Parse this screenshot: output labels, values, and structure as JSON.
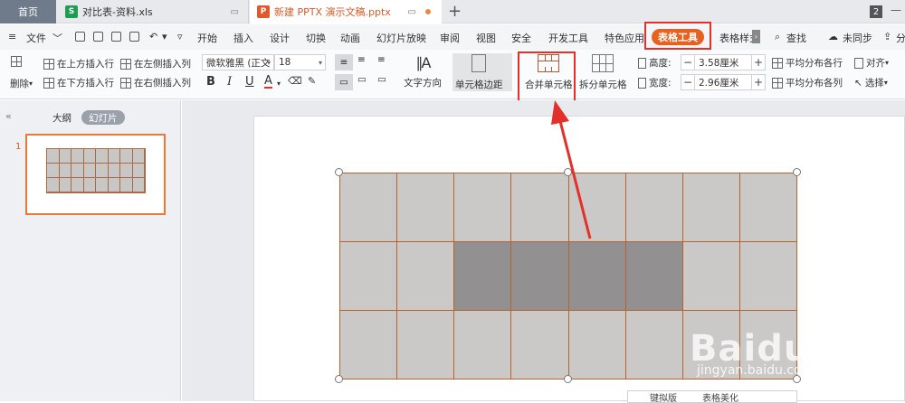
{
  "tabs": {
    "home": "首页",
    "xls": {
      "icon": "S",
      "label": "对比表-资料.xls"
    },
    "ppt": {
      "icon": "P",
      "label": "新建 PPTX 演示文稿.pptx"
    },
    "new_tab": "+",
    "window_count": "2"
  },
  "menu": {
    "file": "文件",
    "items": [
      "开始",
      "插入",
      "设计",
      "切换",
      "动画",
      "幻灯片放映",
      "审阅",
      "视图",
      "安全",
      "开发工具",
      "特色应用"
    ],
    "table_tools": "表格工具",
    "table_style": "表格样式",
    "search": "查找",
    "sync": "未同步",
    "share": "分"
  },
  "ribbon": {
    "delete": "删除",
    "insert_above": "在上方插入行",
    "insert_below": "在下方插入行",
    "insert_left": "在左侧插入列",
    "insert_right": "在右侧插入列",
    "font": "微软雅黑 (正文",
    "font_size": "18",
    "bold": "B",
    "italic": "I",
    "underline": "U",
    "font_color": "A",
    "text_direction": "文字方向",
    "cell_margin": "单元格边距",
    "merge_cells": "合并单元格",
    "split_cells": "拆分单元格",
    "height_label": "高度:",
    "height_value": "3.58厘米",
    "width_label": "宽度:",
    "width_value": "2.96厘米",
    "distribute_rows": "平均分布各行",
    "distribute_cols": "平均分布各列",
    "align": "对齐",
    "select": "选择"
  },
  "panel": {
    "outline_tab": "大纲",
    "slides_tab": "幻灯片",
    "slide_number": "1"
  },
  "table": {
    "rows": 3,
    "cols": 8,
    "selected_row": 1,
    "selected_cols": [
      2,
      3,
      4,
      5
    ]
  },
  "popover": {
    "item1": "键拟版",
    "item2": "表格美化"
  },
  "watermark": {
    "brand": "Baidu经验",
    "url": "jingyan.baidu.com"
  },
  "colors": {
    "accent": "#e8621f",
    "highlight_box": "#e2312b",
    "table_border": "#b8622f",
    "cell_fill": "#cbc9c8",
    "cell_selected": "#929090"
  }
}
